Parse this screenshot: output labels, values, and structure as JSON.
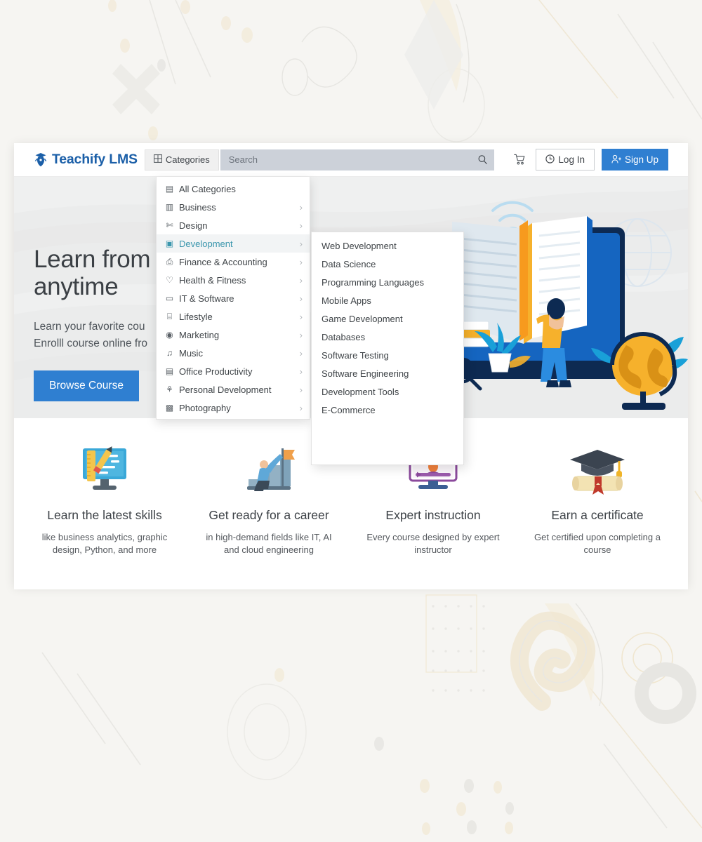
{
  "header": {
    "logo_text": "Teachify LMS",
    "logo_icon": "graduation-emblem-icon",
    "categories_button": "Categories",
    "categories_icon": "grid-icon",
    "search_placeholder": "Search",
    "search_value": "",
    "search_icon": "search-icon",
    "cart_icon": "shopping-cart-icon",
    "login_label": "Log In",
    "login_icon": "sign-in-icon",
    "signup_label": "Sign Up",
    "signup_icon": "user-plus-icon",
    "accent_color": "#2f7fd1",
    "logo_color": "#1b5fa8"
  },
  "hero": {
    "title_line1": "Learn from",
    "title_line2": "anytime",
    "sub_line1": "Learn your favorite cou",
    "sub_line2": "Enrolll course online fro",
    "cta_label": "Browse Course",
    "background_color": "#ebecec",
    "illustration": "open-book-globe-student-illustration"
  },
  "dropdown": {
    "active_item": "Development",
    "active_color": "#3a96ad",
    "items": [
      {
        "label": "All Categories",
        "icon": "table-icon",
        "has_submenu": false
      },
      {
        "label": "Business",
        "icon": "bar-chart-icon",
        "has_submenu": true
      },
      {
        "label": "Design",
        "icon": "vector-icon",
        "has_submenu": true
      },
      {
        "label": "Development",
        "icon": "code-window-icon",
        "has_submenu": true
      },
      {
        "label": "Finance & Accounting",
        "icon": "briefcase-icon",
        "has_submenu": true
      },
      {
        "label": "Health & Fitness",
        "icon": "heartbeat-icon",
        "has_submenu": true
      },
      {
        "label": "IT & Software",
        "icon": "desktop-icon",
        "has_submenu": true
      },
      {
        "label": "Lifestyle",
        "icon": "building-icon",
        "has_submenu": true
      },
      {
        "label": "Marketing",
        "icon": "bullseye-icon",
        "has_submenu": true
      },
      {
        "label": "Music",
        "icon": "music-note-icon",
        "has_submenu": true
      },
      {
        "label": "Office Productivity",
        "icon": "document-icon",
        "has_submenu": true
      },
      {
        "label": "Personal Development",
        "icon": "lightbulb-icon",
        "has_submenu": true
      },
      {
        "label": "Photography",
        "icon": "camera-icon",
        "has_submenu": true
      }
    ],
    "submenu": [
      "Web Development",
      "Data Science",
      "Programming Languages",
      "Mobile Apps",
      "Game Development",
      "Databases",
      "Software Testing",
      "Software Engineering",
      "Development Tools",
      "E-Commerce"
    ]
  },
  "features": [
    {
      "icon": "monitor-ruler-pencil-icon",
      "title": "Learn the latest skills",
      "desc": "like business analytics, graphic design, Python, and more"
    },
    {
      "icon": "career-stairs-flag-icon",
      "title": "Get ready for a career",
      "desc": "in high-demand fields like IT, AI and cloud engineering"
    },
    {
      "icon": "video-instructor-icon",
      "title": "Expert instruction",
      "desc": "Every course designed by expert instructor"
    },
    {
      "icon": "graduation-cap-diploma-icon",
      "title": "Earn a certificate",
      "desc": "Get certified upon completing a course"
    }
  ]
}
